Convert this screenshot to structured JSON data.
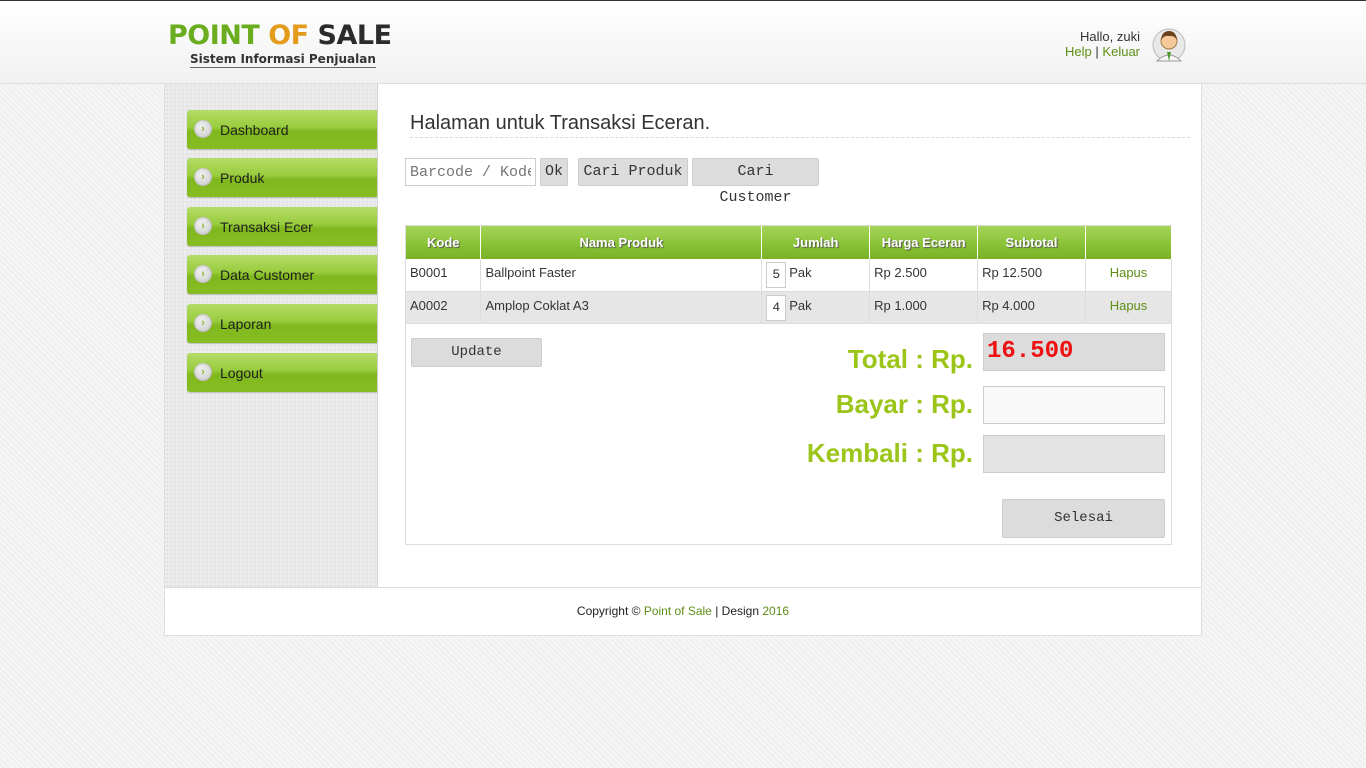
{
  "header": {
    "logo": {
      "word1": "POINT",
      "word2": "OF",
      "word3": "SALE",
      "subtitle": "Sistem Informasi Penjualan"
    },
    "user": {
      "greeting": "Hallo, zuki",
      "help": "Help",
      "separator": "|",
      "logout": "Keluar"
    }
  },
  "sidebar": {
    "items": [
      {
        "label": "Dashboard"
      },
      {
        "label": "Produk"
      },
      {
        "label": "Transaksi Ecer"
      },
      {
        "label": "Data Customer"
      },
      {
        "label": "Laporan"
      },
      {
        "label": "Logout"
      }
    ]
  },
  "main": {
    "title": "Halaman untuk Transaksi Eceran.",
    "search": {
      "placeholder": "Barcode / Kode",
      "ok": "Ok",
      "find_product": "Cari Produk",
      "find_customer": "Cari Customer"
    },
    "table": {
      "headers": [
        "Kode",
        "Nama Produk",
        "Jumlah",
        "Harga Eceran",
        "Subtotal",
        ""
      ],
      "rows": [
        {
          "kode": "B0001",
          "nama": "Ballpoint Faster",
          "qty": "5",
          "unit": "Pak",
          "harga": "Rp 2.500",
          "subtotal": "Rp 12.500",
          "action": "Hapus"
        },
        {
          "kode": "A0002",
          "nama": "Amplop Coklat A3",
          "qty": "4",
          "unit": "Pak",
          "harga": "Rp 1.000",
          "subtotal": "Rp 4.000",
          "action": "Hapus"
        }
      ]
    },
    "update_label": "Update",
    "summary": {
      "total_label": "Total : Rp.",
      "total_value": "16.500",
      "bayar_label": "Bayar : Rp.",
      "bayar_value": "",
      "kembali_label": "Kembali : Rp.",
      "kembali_value": ""
    },
    "finish_label": "Selesai"
  },
  "footer": {
    "prefix": "Copyright ©",
    "brand": "Point of Sale",
    "middle": "| Design",
    "year": "2016"
  },
  "colors": {
    "accent_green": "#8cc43a",
    "label_green": "#9cc51a",
    "total_red": "#ee1111",
    "link_green": "#5e8e16"
  }
}
